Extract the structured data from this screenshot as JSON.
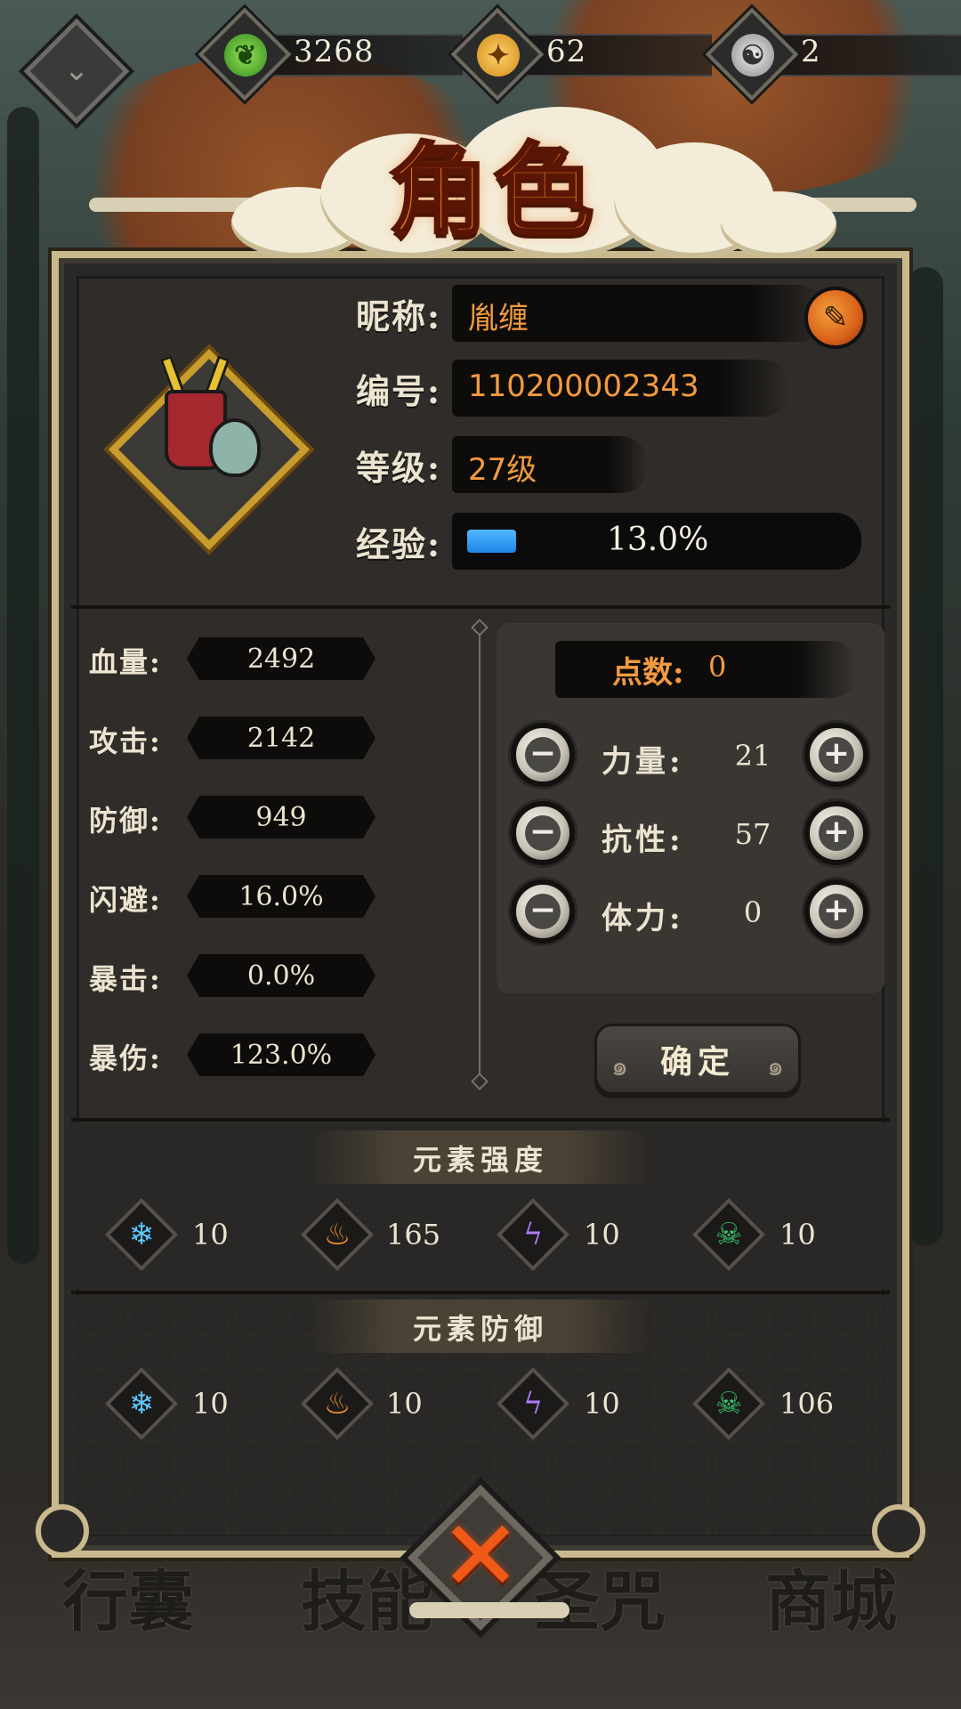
{
  "resources": [
    {
      "icon": "green-jade-icon",
      "value": "3268",
      "color": "#5ed13a"
    },
    {
      "icon": "gold-coin-icon",
      "value": "62",
      "color": "#f2b23a"
    },
    {
      "icon": "yinyang-token-icon",
      "value": "2",
      "color": "#bdbdbd"
    }
  ],
  "title": "角色",
  "profile": {
    "nickname_label": "昵称:",
    "nickname": "胤缠",
    "id_label": "编号:",
    "id": "110200002343",
    "level_label": "等级:",
    "level": "27级",
    "exp_label": "经验:",
    "exp_text": "13.0%",
    "exp_fraction": 0.13
  },
  "stats": [
    {
      "label": "血量:",
      "value": "2492"
    },
    {
      "label": "攻击:",
      "value": "2142"
    },
    {
      "label": "防御:",
      "value": "949"
    },
    {
      "label": "闪避:",
      "value": "16.0%"
    },
    {
      "label": "暴击:",
      "value": "0.0%"
    },
    {
      "label": "暴伤:",
      "value": "123.0%"
    }
  ],
  "points": {
    "label": "点数:",
    "value": "0",
    "attributes": [
      {
        "label": "力量:",
        "value": "21"
      },
      {
        "label": "抗性:",
        "value": "57"
      },
      {
        "label": "体力:",
        "value": "0"
      }
    ],
    "minus_symbol": "−",
    "plus_symbol": "+",
    "confirm_label": "确定"
  },
  "element_strength": {
    "title": "元素强度",
    "items": [
      {
        "icon": "ice-snowflake-icon",
        "value": "10",
        "color": "#5cc8ff"
      },
      {
        "icon": "fire-icon",
        "value": "165",
        "color": "#f2922a"
      },
      {
        "icon": "lightning-icon",
        "value": "10",
        "color": "#b27dff"
      },
      {
        "icon": "poison-skull-icon",
        "value": "10",
        "color": "#39c46a"
      }
    ]
  },
  "element_defense": {
    "title": "元素防御",
    "items": [
      {
        "icon": "ice-snowflake-icon",
        "value": "10",
        "color": "#5cc8ff"
      },
      {
        "icon": "fire-icon",
        "value": "10",
        "color": "#f2922a"
      },
      {
        "icon": "lightning-icon",
        "value": "10",
        "color": "#b27dff"
      },
      {
        "icon": "poison-skull-icon",
        "value": "106",
        "color": "#39c46a"
      }
    ]
  },
  "bottom_menu": [
    "行囊",
    "技能",
    "圣咒",
    "商城"
  ],
  "close_symbol": "✕"
}
